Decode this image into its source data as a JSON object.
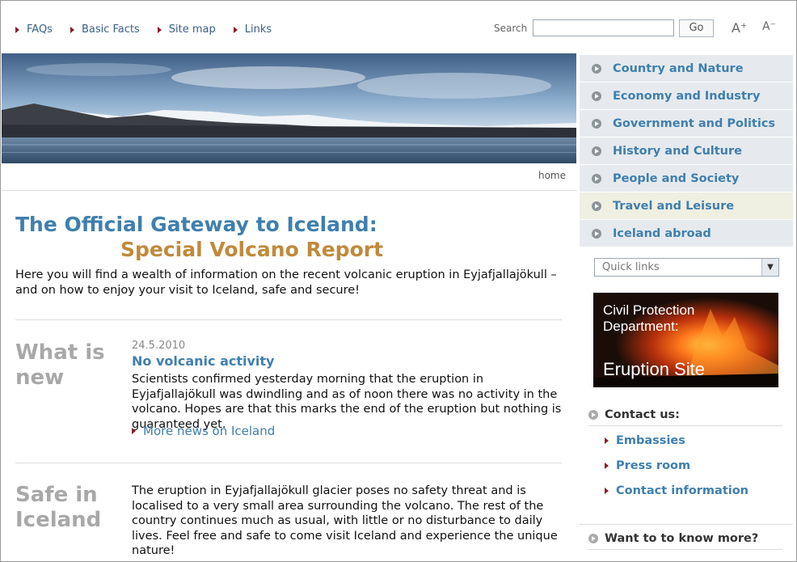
{
  "top_nav": [
    {
      "label": "FAQs"
    },
    {
      "label": "Basic Facts"
    },
    {
      "label": "Site map"
    },
    {
      "label": "Links"
    }
  ],
  "search": {
    "label": "Search",
    "value": "",
    "go_label": "Go"
  },
  "font_controls": {
    "increase": "A⁺",
    "decrease": "A⁻"
  },
  "breadcrumb": "home",
  "heading": {
    "line1": "The Official Gateway to Iceland:",
    "line2": "Special Volcano Report"
  },
  "intro": "Here you will find a wealth of information on the recent volcanic eruption in Eyjafjallajökull – and on how to enjoy your visit to Iceland, safe and secure!",
  "whats_new": {
    "section_title": "What is new",
    "date": "24.5.2010",
    "title": "No volcanic activity",
    "body": "Scientists confirmed yesterday morning that the eruption in Eyjafjallajökull was dwindling and as of noon there was no activity in the volcano. Hopes are that this marks the end of the eruption but nothing is guaranteed yet.",
    "more_link": "More news on Iceland"
  },
  "safe": {
    "section_title": "Safe in Iceland",
    "body": "The eruption in Eyjafjallajökull glacier poses no safety threat and is localised to a very small area surrounding the volcano. The rest of the country continues much as usual, with little or no disturbance to daily lives. Feel free and safe to come visit Iceland and experience the unique nature!"
  },
  "side_nav": [
    {
      "label": "Country and Nature",
      "active": false
    },
    {
      "label": "Economy and Industry",
      "active": false
    },
    {
      "label": "Government and Politics",
      "active": false
    },
    {
      "label": "History and Culture",
      "active": false
    },
    {
      "label": "People and Society",
      "active": false
    },
    {
      "label": "Travel and Leisure",
      "active": true
    },
    {
      "label": "Iceland abroad",
      "active": false
    }
  ],
  "quick_links": {
    "selected": "Quick links"
  },
  "civil_protection": {
    "line1": "Civil Protection",
    "line2": "Department:",
    "line3": "Eruption Site"
  },
  "contact": {
    "heading": "Contact us:",
    "links": [
      "Embassies",
      "Press room",
      "Contact information"
    ]
  },
  "want_more": {
    "heading": "Want to to know more?"
  },
  "colors": {
    "link_blue": "#3f7fae",
    "accent_gold": "#c08a3c",
    "bullet_red": "#8a1e2b",
    "heading_gray": "#a8a8a8"
  }
}
